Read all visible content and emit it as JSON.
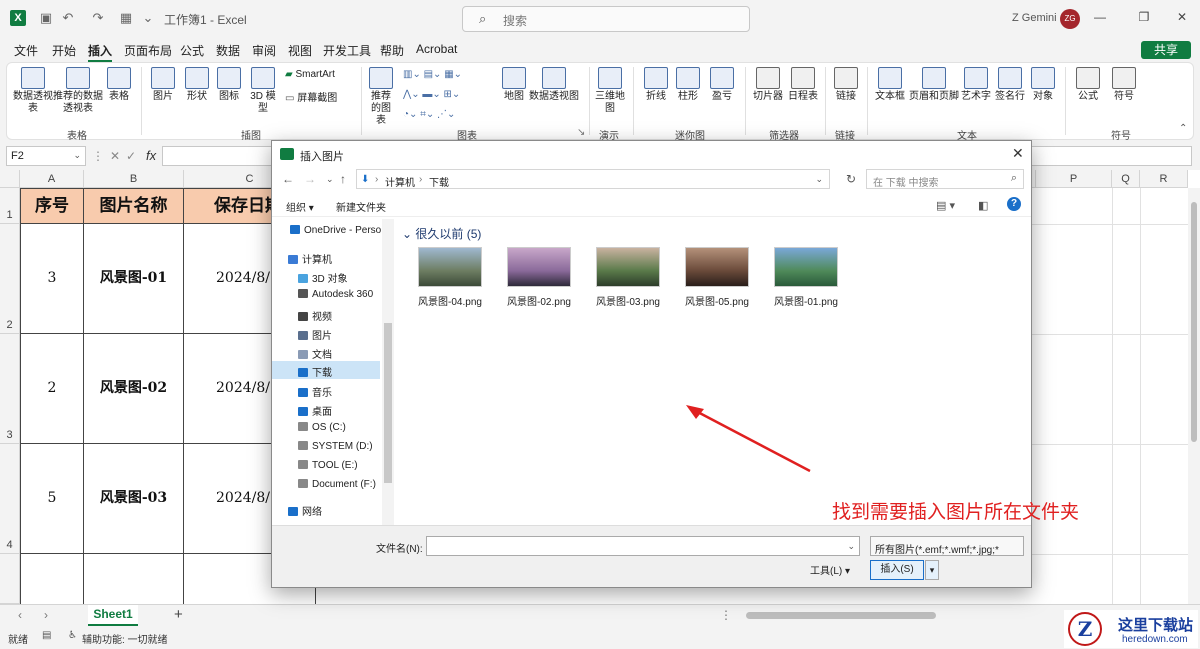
{
  "app": {
    "doc_title": "工作簿1 - Excel",
    "search_placeholder": "搜索",
    "user_name": "Z Gemini",
    "user_initials": "ZG",
    "logo_letter": "X"
  },
  "tabs": [
    "文件",
    "开始",
    "插入",
    "页面布局",
    "公式",
    "数据",
    "审阅",
    "视图",
    "开发工具",
    "帮助",
    "Acrobat"
  ],
  "active_tab": "插入",
  "share_label": "共享",
  "ribbon": {
    "table_group": {
      "label": "表格",
      "pivot": "数据透视表",
      "recommended_pivot": "推荐的数据透视表",
      "table": "表格"
    },
    "illustrations_group": {
      "label": "插图",
      "pictures": "图片",
      "shapes": "形状",
      "icons": "图标",
      "models_3d": "3D 模型",
      "smartart": "SmartArt",
      "screenshot": "屏幕截图"
    },
    "charts_group": {
      "label": "图表",
      "recommended": "推荐的图表",
      "map": "地图",
      "pivot_chart": "数据透视图"
    },
    "tours_group": {
      "label": "演示",
      "map3d": "三维地图"
    },
    "sparklines_group": {
      "label": "迷你图",
      "line": "折线",
      "column": "柱形",
      "winloss": "盈亏"
    },
    "filters_group": {
      "label": "筛选器",
      "slicer": "切片器",
      "timeline": "日程表"
    },
    "links_group": {
      "label": "链接",
      "link": "链接"
    },
    "text_group": {
      "label": "文本",
      "textbox": "文本框",
      "header_footer": "页眉和页脚",
      "wordart": "艺术字",
      "signature": "签名行",
      "object": "对象"
    },
    "symbols_group": {
      "label": "符号",
      "equation": "公式",
      "symbol": "符号"
    }
  },
  "formula_bar": {
    "name_box": "F2",
    "fx": "fx",
    "value": ""
  },
  "columns": [
    "A",
    "B",
    "C",
    "P",
    "Q",
    "R"
  ],
  "rows": [
    "1",
    "2",
    "3",
    "4"
  ],
  "table": {
    "headers": [
      "序号",
      "图片名称",
      "保存日期"
    ],
    "rows": [
      [
        "3",
        "风景图-01",
        "2024/8/"
      ],
      [
        "2",
        "风景图-02",
        "2024/8/"
      ],
      [
        "5",
        "风景图-03",
        "2024/8/"
      ]
    ]
  },
  "sheet_tab": "Sheet1",
  "status": {
    "ready": "就绪",
    "accessibility": "辅助功能: 一切就绪"
  },
  "dialog": {
    "title": "插入图片",
    "breadcrumb": [
      "计算机",
      "下载"
    ],
    "search_placeholder": "在 下载 中搜索",
    "organize": "组织",
    "new_folder": "新建文件夹",
    "nav_items": [
      {
        "label": "OneDrive - Perso",
        "icon": "cloud-icon",
        "color": "#1a6fc9"
      },
      {
        "label": "计算机",
        "icon": "computer-icon",
        "color": "#3a7bd5"
      },
      {
        "label": "3D 对象",
        "icon": "cube-icon",
        "color": "#4aa3df"
      },
      {
        "label": "Autodesk 360",
        "icon": "autodesk-icon",
        "color": "#555555"
      },
      {
        "label": "视频",
        "icon": "video-icon",
        "color": "#444444"
      },
      {
        "label": "图片",
        "icon": "pictures-icon",
        "color": "#5a6f8e"
      },
      {
        "label": "文档",
        "icon": "documents-icon",
        "color": "#8a9bb5"
      },
      {
        "label": "下载",
        "icon": "download-icon",
        "color": "#1a6fc9"
      },
      {
        "label": "音乐",
        "icon": "music-icon",
        "color": "#1a6fc9"
      },
      {
        "label": "桌面",
        "icon": "desktop-icon",
        "color": "#1a6fc9"
      },
      {
        "label": "OS (C:)",
        "icon": "drive-icon",
        "color": "#888888"
      },
      {
        "label": "SYSTEM (D:)",
        "icon": "drive-icon",
        "color": "#888888"
      },
      {
        "label": "TOOL (E:)",
        "icon": "drive-icon",
        "color": "#888888"
      },
      {
        "label": "Document (F:)",
        "icon": "drive-icon",
        "color": "#888888"
      },
      {
        "label": "网络",
        "icon": "network-icon",
        "color": "#1a6fc9"
      }
    ],
    "group_header": "很久以前 (5)",
    "files": [
      {
        "name": "风景图-04.png",
        "palette": [
          "#9fb8d0",
          "#6d7d62",
          "#3c4a38"
        ]
      },
      {
        "name": "风景图-02.png",
        "palette": [
          "#c8a7c9",
          "#8a6a9a",
          "#2e2a3a"
        ]
      },
      {
        "name": "风景图-03.png",
        "palette": [
          "#c9b2a0",
          "#5a7a4a",
          "#2d3d2a"
        ]
      },
      {
        "name": "风景图-05.png",
        "palette": [
          "#b4917a",
          "#6a4a3a",
          "#2a1e1a"
        ]
      },
      {
        "name": "风景图-01.png",
        "palette": [
          "#7aa8d8",
          "#4f8a5a",
          "#2a5a3a"
        ]
      }
    ],
    "annotation": "找到需要插入图片所在文件夹",
    "filename_label": "文件名(N):",
    "filename_value": "",
    "filetype": "所有图片(*.emf;*.wmf;*.jpg;*",
    "tools": "工具(L)",
    "insert": "插入(S)"
  },
  "watermark": {
    "cn": "这里下载站",
    "en": "heredown.com",
    "letter": "Z"
  },
  "colors": {
    "accent": "#107c41",
    "header_fill": "#f8cbad",
    "annotation": "#e02020"
  }
}
